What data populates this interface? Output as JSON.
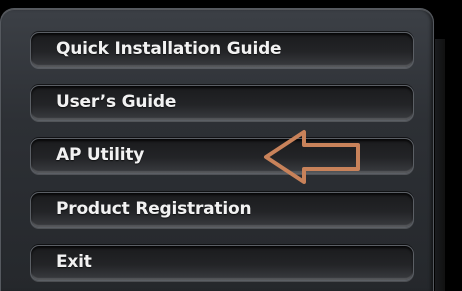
{
  "menu": {
    "items": [
      {
        "label": "Quick Installation Guide"
      },
      {
        "label": "User’s Guide"
      },
      {
        "label": "AP Utility"
      },
      {
        "label": "Product Registration"
      },
      {
        "label": "Exit"
      }
    ]
  },
  "colors": {
    "arrow": "#c8825a",
    "text": "#f2f2f2",
    "panel": "#2d3035"
  },
  "icons": {
    "arrow": "left-arrow-icon"
  }
}
